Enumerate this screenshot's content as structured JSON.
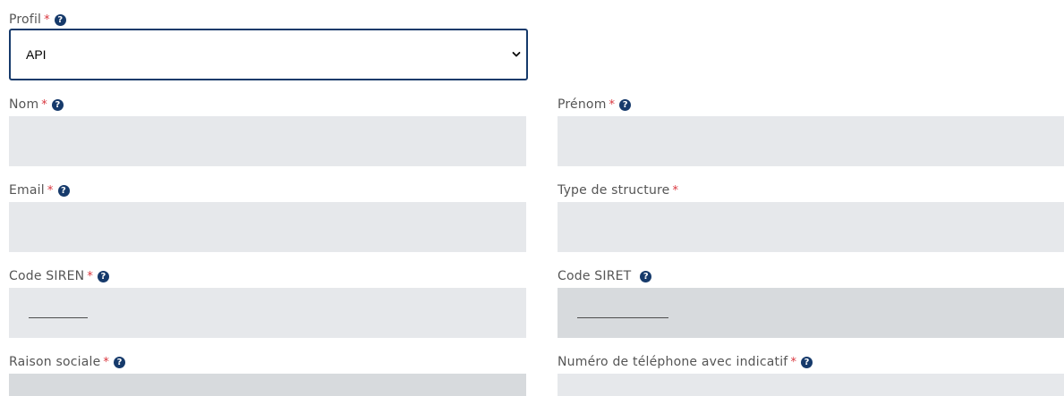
{
  "required_marker": "*",
  "help_glyph": "?",
  "colors": {
    "accent": "#163a6b",
    "required": "#d9363e",
    "input_bg": "#e6e8eb",
    "input_disabled_bg": "#d7dadd"
  },
  "profil": {
    "label": "Profil",
    "value": "API"
  },
  "nom": {
    "label": "Nom"
  },
  "prenom": {
    "label": "Prénom"
  },
  "email": {
    "label": "Email"
  },
  "type_structure": {
    "label": "Type de structure"
  },
  "code_siren": {
    "label": "Code SIREN"
  },
  "code_siret": {
    "label": "Code SIRET"
  },
  "raison_sociale": {
    "label": "Raison sociale"
  },
  "telephone": {
    "label": "Numéro de téléphone avec indicatif"
  }
}
